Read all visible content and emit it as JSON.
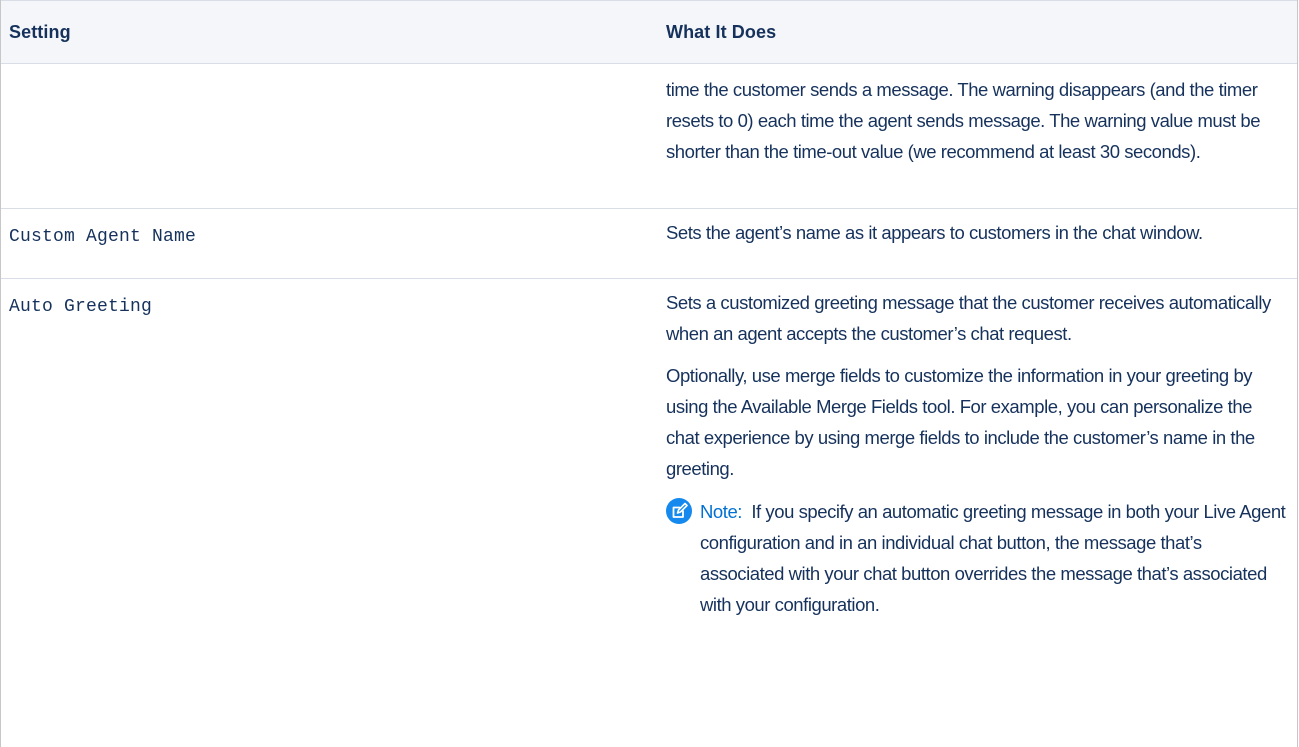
{
  "table": {
    "headers": {
      "setting": "Setting",
      "what_it_does": "What It Does"
    },
    "rows": [
      {
        "setting": "",
        "description": [
          "time the customer sends a message. The warning disappears (and the timer resets to 0) each time the agent sends message. The warning value must be shorter than the time-out value (we recommend at least 30 seconds)."
        ]
      },
      {
        "setting": "Custom Agent Name",
        "description": [
          "Sets the agent’s name as it appears to customers in the chat window."
        ]
      },
      {
        "setting": "Auto Greeting",
        "description": [
          "Sets a customized greeting message that the customer receives automatically when an agent accepts the customer’s chat request.",
          "Optionally, use merge fields to customize the information in your greeting by using the Available Merge Fields tool. For example, you can personalize the chat experience by using merge fields to include the customer’s name in the greeting."
        ],
        "note": {
          "label": "Note:",
          "text": "If you specify an automatic greeting message in both your Live Agent configuration and in an individual chat button, the message that’s associated with your chat button overrides the message that’s associated with your configuration.",
          "icon": "note-edit-icon",
          "icon_color": "#1589ee"
        }
      }
    ]
  },
  "colors": {
    "text": "#16325c",
    "header_bg": "#f4f6f9",
    "note_label": "#0070d2"
  }
}
